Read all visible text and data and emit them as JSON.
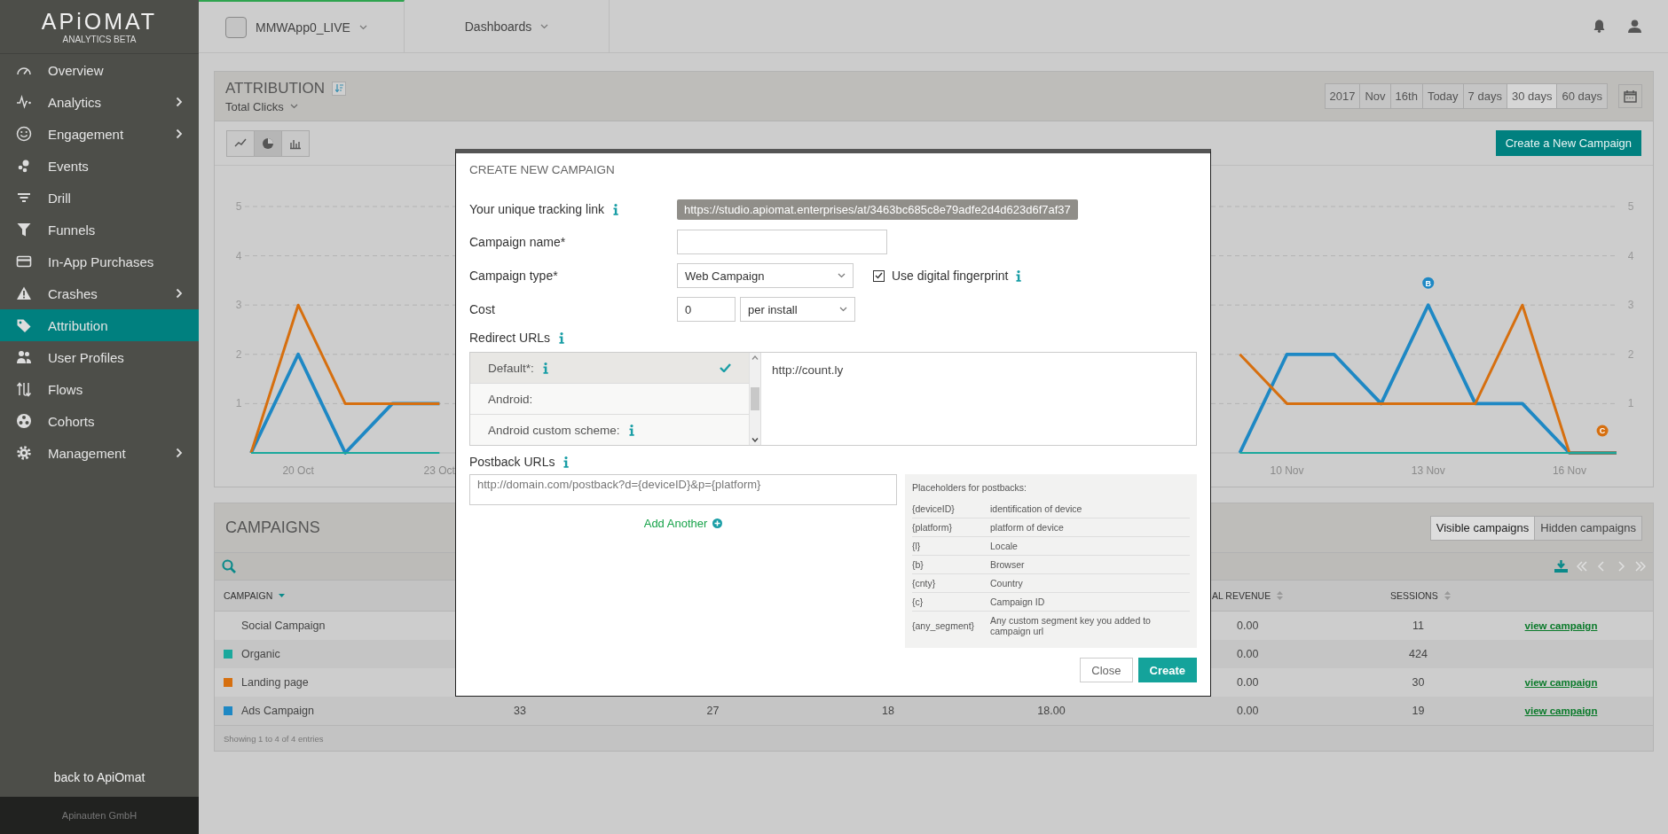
{
  "sidebar": {
    "logo": "APiOMAT",
    "subtitle": "ANALYTICS BETA",
    "items": [
      {
        "label": "Overview",
        "selected": false,
        "expandable": false
      },
      {
        "label": "Analytics",
        "selected": false,
        "expandable": true
      },
      {
        "label": "Engagement",
        "selected": false,
        "expandable": true
      },
      {
        "label": "Events",
        "selected": false,
        "expandable": false
      },
      {
        "label": "Drill",
        "selected": false,
        "expandable": false
      },
      {
        "label": "Funnels",
        "selected": false,
        "expandable": false
      },
      {
        "label": "In-App Purchases",
        "selected": false,
        "expandable": false
      },
      {
        "label": "Crashes",
        "selected": false,
        "expandable": true
      },
      {
        "label": "Attribution",
        "selected": true,
        "expandable": false
      },
      {
        "label": "User Profiles",
        "selected": false,
        "expandable": false
      },
      {
        "label": "Flows",
        "selected": false,
        "expandable": false
      },
      {
        "label": "Cohorts",
        "selected": false,
        "expandable": false
      },
      {
        "label": "Management",
        "selected": false,
        "expandable": true
      }
    ],
    "back_link": "back to ApiOmat",
    "footer": "Apinauten GmbH"
  },
  "topbar": {
    "app_selector": "MMWApp0_LIVE",
    "dashboards": "Dashboards"
  },
  "attribution": {
    "title": "ATTRIBUTION",
    "metric": "Total Clicks",
    "date_ranges": [
      {
        "label": "2017",
        "selected": false
      },
      {
        "label": "Nov",
        "selected": false
      },
      {
        "label": "16th",
        "selected": false
      },
      {
        "label": "Today",
        "selected": false
      },
      {
        "label": "7 days",
        "selected": false
      },
      {
        "label": "30 days",
        "selected": true
      },
      {
        "label": "60 days",
        "selected": false
      }
    ],
    "chart_types": [
      {
        "kind": "line",
        "selected": false
      },
      {
        "kind": "pie",
        "selected": true
      },
      {
        "kind": "bar",
        "selected": false
      }
    ],
    "create_button": "Create a New Campaign",
    "chart_data": {
      "type": "line",
      "categories": [
        null,
        "20 Oct",
        null,
        null,
        "23 Oct",
        null,
        null,
        null,
        null,
        null,
        null,
        null,
        null,
        null,
        null,
        null,
        null,
        null,
        null,
        null,
        null,
        null,
        "10 Nov",
        null,
        null,
        "13 Nov",
        null,
        null,
        "16 Nov",
        null
      ],
      "yticks": [
        1,
        2,
        3,
        4,
        5
      ],
      "y2ticks": [
        1,
        2,
        3,
        4,
        5
      ],
      "ylim": [
        0,
        5
      ],
      "y2lim": [
        0,
        5
      ],
      "grid": true,
      "series": [
        {
          "color": "#1aa89c",
          "values": [
            0,
            0,
            0,
            0,
            0,
            null,
            null,
            null,
            null,
            null,
            null,
            null,
            null,
            null,
            null,
            null,
            null,
            null,
            null,
            null,
            null,
            0,
            0,
            0,
            0,
            0,
            0,
            0,
            0,
            0
          ]
        },
        {
          "color": "#d66f0f",
          "values": [
            0,
            3,
            1,
            1,
            1,
            null,
            null,
            null,
            null,
            null,
            null,
            null,
            null,
            null,
            null,
            null,
            null,
            null,
            null,
            null,
            null,
            2,
            1,
            1,
            1,
            1,
            1,
            3,
            0,
            0
          ]
        },
        {
          "color": "#1e88c4",
          "values": [
            0,
            2,
            0,
            1,
            1,
            null,
            null,
            null,
            null,
            null,
            null,
            null,
            null,
            null,
            null,
            null,
            null,
            null,
            null,
            null,
            null,
            0,
            2,
            2,
            1,
            3,
            1,
            1,
            0,
            0
          ]
        }
      ],
      "annotations": [
        {
          "text": "B",
          "x": "13 Nov",
          "y": 3.45
        },
        "C"
      ]
    }
  },
  "campaigns": {
    "title": "CAMPAIGNS",
    "filters": [
      {
        "label": "Visible campaigns",
        "selected": true
      },
      {
        "label": "Hidden campaigns",
        "selected": false
      }
    ],
    "columns": [
      {
        "label": "CAMPAIGN",
        "sorted": true
      },
      null,
      null,
      null,
      null,
      {
        "label": "AL REVENUE",
        "sorted": false
      },
      {
        "label": "SESSIONS",
        "sorted": false
      },
      null
    ],
    "rows": [
      {
        "cells": [
          "Social Campaign",
          "",
          "",
          "",
          "",
          "0.00",
          "11",
          "view campaign"
        ]
      },
      {
        "color": "#1aa89c",
        "cells": [
          "Organic",
          "",
          "",
          "",
          "",
          "0.00",
          "424",
          ""
        ]
      },
      {
        "color": "#d66f0f",
        "cells": [
          "Landing page",
          "",
          "",
          "",
          "",
          "0.00",
          "30",
          "view campaign"
        ]
      },
      {
        "color": "#1e88c4",
        "cells": [
          "Ads Campaign",
          "33",
          "27",
          "18",
          "18.00",
          "0.00",
          "19",
          "view campaign"
        ]
      }
    ],
    "footer": "Showing 1 to 4 of 4 entries"
  },
  "modal": {
    "title": "CREATE NEW CAMPAIGN",
    "tracking_link": {
      "label": "Your unique tracking link",
      "value": "https://studio.apiomat.enterprises/at/3463bc685c8e79adfe2d4d623d6f7af37"
    },
    "campaign_name": {
      "label": "Campaign name*"
    },
    "campaign_type": {
      "label": "Campaign type*",
      "value": "Web Campaign"
    },
    "fingerprint": {
      "label": "Use digital fingerprint",
      "checked": true
    },
    "cost": {
      "label": "Cost",
      "value": "0",
      "unit": "per install"
    },
    "redirect": {
      "label": "Redirect URLs",
      "platforms": [
        {
          "label": "Default*:",
          "info": true,
          "selected": true
        },
        {
          "label": "Android:",
          "info": false,
          "selected": false
        },
        {
          "label": "Android custom scheme:",
          "info": true,
          "selected": false
        }
      ],
      "url": "http://count.ly"
    },
    "postback": {
      "label": "Postback URLs",
      "placeholder": "http://domain.com/postback?d={deviceID}&p={platform}",
      "add_link": "Add Another",
      "help_title": "Placeholders for postbacks:",
      "placeholders": [
        {
          "key": "{deviceID}",
          "description": "identification of device"
        },
        {
          "key": "{platform}",
          "description": "platform of device"
        },
        {
          "key": "{l}",
          "description": "Locale"
        },
        {
          "key": "{b}",
          "description": "Browser"
        },
        {
          "key": "{cnty}",
          "description": "Country"
        },
        {
          "key": "{c}",
          "description": "Campaign ID"
        },
        {
          "key": "{any_segment}",
          "description": "Any custom segment key you added to campaign url"
        }
      ]
    },
    "buttons": [
      {
        "label": "Close",
        "kind": "secondary"
      },
      {
        "label": "Create",
        "kind": "primary"
      }
    ]
  }
}
